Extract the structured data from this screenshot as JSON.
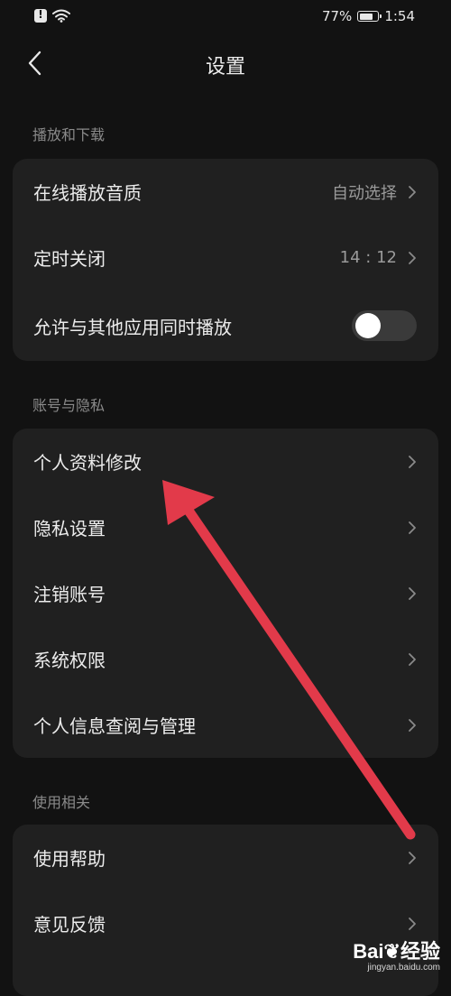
{
  "status_bar": {
    "battery": "77%",
    "battery_level": 0.77,
    "time": "1:54"
  },
  "header": {
    "title": "设置"
  },
  "sections": [
    {
      "title": "播放和下载",
      "items": [
        {
          "label": "在线播放音质",
          "value": "自动选择"
        },
        {
          "label": "定时关闭",
          "value": "14 : 12"
        },
        {
          "label": "允许与其他应用同时播放",
          "toggle": false
        }
      ]
    },
    {
      "title": "账号与隐私",
      "items": [
        {
          "label": "个人资料修改"
        },
        {
          "label": "隐私设置"
        },
        {
          "label": "注销账号"
        },
        {
          "label": "系统权限"
        },
        {
          "label": "个人信息查阅与管理"
        }
      ]
    },
    {
      "title": "使用相关",
      "items": [
        {
          "label": "使用帮助"
        },
        {
          "label": "意见反馈"
        }
      ]
    }
  ],
  "watermark": {
    "brand_prefix": "Bai",
    "brand_suffix": "经验",
    "site": "jingyan.baidu.com"
  },
  "colors": {
    "background": "#121212",
    "card": "#202020",
    "annotation_arrow": "#e23a4a"
  }
}
